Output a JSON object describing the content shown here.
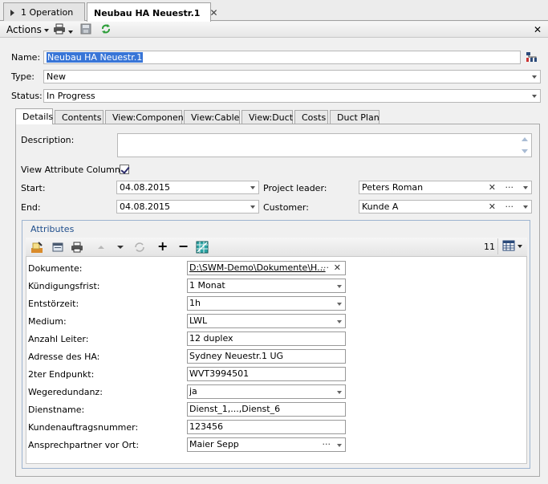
{
  "doc_tabs": [
    {
      "label": "1 Operation"
    },
    {
      "label": "Neubau HA Neuestr.1"
    }
  ],
  "toolbar": {
    "actions_label": "Actions"
  },
  "form": {
    "name_label": "Name:",
    "name_value": "Neubau HA Neuestr.1",
    "type_label": "Type:",
    "type_value": "New",
    "status_label": "Status:",
    "status_value": "In Progress"
  },
  "inner_tabs": [
    {
      "label": "Details"
    },
    {
      "label": "Contents"
    },
    {
      "label": "View:Component"
    },
    {
      "label": "View:Cable"
    },
    {
      "label": "View:Duct"
    },
    {
      "label": "Costs"
    },
    {
      "label": "Duct Plan"
    }
  ],
  "details": {
    "description_label": "Description:",
    "view_attr_label": "View Attribute Columns:",
    "start_label": "Start:",
    "start_value": "04.08.2015",
    "end_label": "End:",
    "end_value": "04.08.2015",
    "project_leader_label": "Project leader:",
    "project_leader_value": "Peters Roman",
    "customer_label": "Customer:",
    "customer_value": "Kunde A"
  },
  "attributes": {
    "title": "Attributes",
    "count": "11",
    "rows": [
      {
        "label": "Dokumente:",
        "value": "D:\\SWM-Demo\\Dokumente\\H..."
      },
      {
        "label": "Kündigungsfrist:",
        "value": "1 Monat"
      },
      {
        "label": "Entstörzeit:",
        "value": "1h"
      },
      {
        "label": "Medium:",
        "value": "LWL"
      },
      {
        "label": "Anzahl Leiter:",
        "value": "12 duplex"
      },
      {
        "label": "Adresse des HA:",
        "value": "Sydney Neuestr.1 UG"
      },
      {
        "label": "2ter Endpunkt:",
        "value": "WVT3994501"
      },
      {
        "label": "Wegeredundanz:",
        "value": "ja"
      },
      {
        "label": "Dienstname:",
        "value": "Dienst_1,...,Dienst_6"
      },
      {
        "label": "Kundenauftragsnummer:",
        "value": "123456"
      },
      {
        "label": "Ansprechpartner vor Ort:",
        "value": "Maier Sepp"
      }
    ]
  },
  "colors": {
    "selection": "#3875d7",
    "group_title": "#1f4e8c"
  }
}
